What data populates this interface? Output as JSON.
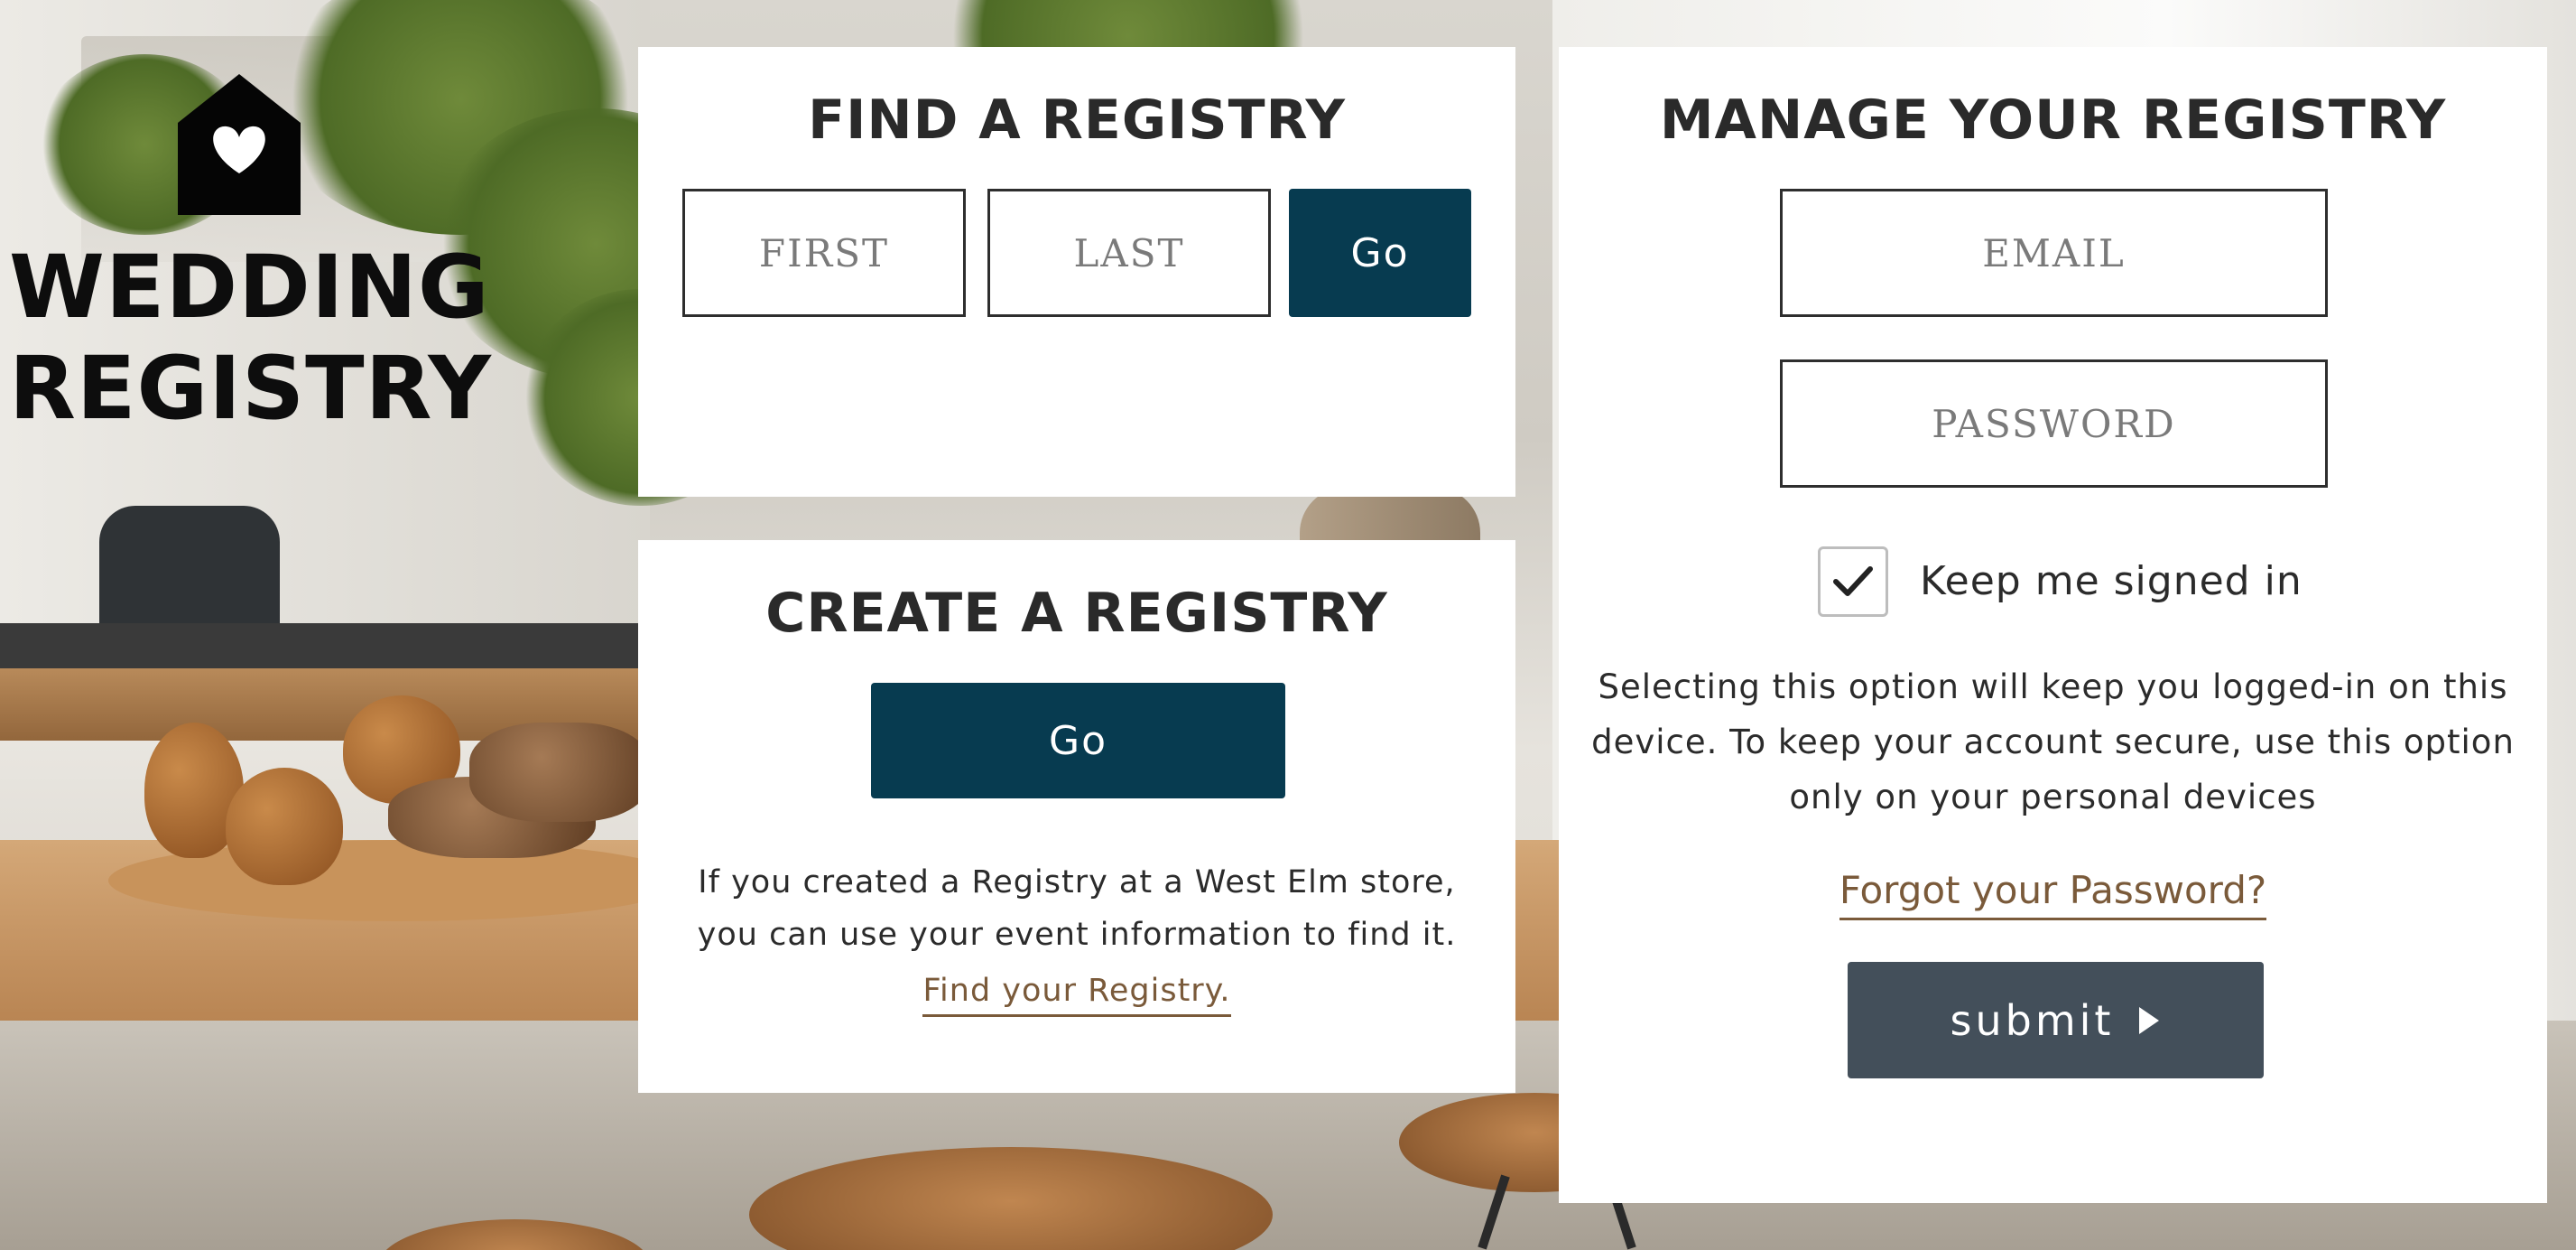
{
  "brand": {
    "title_line1": "WEDDING",
    "title_line2": "REGISTRY",
    "icon": "house-heart-icon"
  },
  "find": {
    "title_bold": "FIND",
    "title_rest": " A REGISTRY",
    "first_placeholder": "FIRST",
    "last_placeholder": "LAST",
    "go_label": "Go"
  },
  "create": {
    "title_bold": "CREATE",
    "title_rest": " A REGISTRY",
    "go_label": "Go",
    "info_line1": "If you created a Registry at a West Elm store,",
    "info_line2": "you can use your event information to find it.",
    "find_link": "Find your Registry."
  },
  "manage": {
    "title_bold": "MANAGE",
    "title_rest": " YOUR REGISTRY",
    "email_placeholder": "EMAIL",
    "password_placeholder": "PASSWORD",
    "keep_signed_in_label": "Keep me signed in",
    "keep_signed_in_checked": true,
    "info_line1": "Selecting this option will keep you logged-in on this",
    "info_line2": "device. To keep your account secure, use this option",
    "info_line3": "only on your personal devices",
    "forgot_link": "Forgot your Password?",
    "submit_label": "submit",
    "submit_icon": "caret-right-icon"
  },
  "colors": {
    "primary_button": "#073b50",
    "submit_button": "#434f5a",
    "link": "#7a5a3a"
  }
}
